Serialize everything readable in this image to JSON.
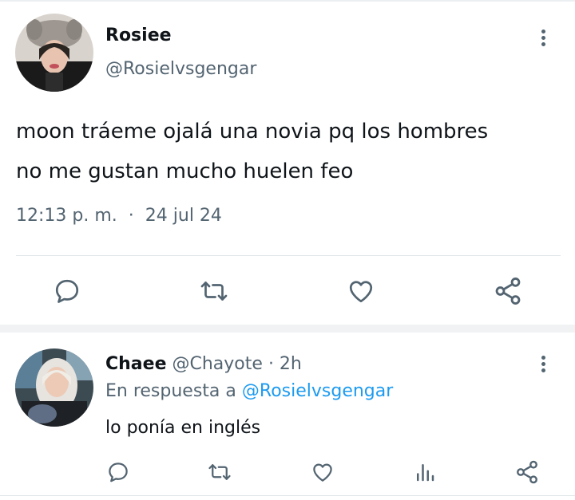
{
  "tweet": {
    "author_name": "Rosiee",
    "author_handle": "@Rosielvsgengar",
    "text_line1": "moon tráeme ojalá una novia pq los hombres",
    "text_line2": "no me gustan mucho huelen feo",
    "time": "12:13 p. m.",
    "separator": "·",
    "date": "24 jul 24",
    "actions": [
      "reply-icon",
      "retweet-icon",
      "like-icon",
      "share-icon"
    ]
  },
  "reply": {
    "author_name": "Chaee",
    "author_handle": "@Chayote",
    "age": "· 2h",
    "reply_prefix": "En respuesta a",
    "reply_mention": "@Rosielvsgengar",
    "text": "lo ponía en inglés",
    "actions": [
      "reply-icon",
      "retweet-icon",
      "like-icon",
      "stats-icon",
      "share-icon"
    ]
  },
  "colors": {
    "text": "#0f1419",
    "secondary": "#536471",
    "link": "#1d9bf0",
    "icon": "#536471"
  }
}
